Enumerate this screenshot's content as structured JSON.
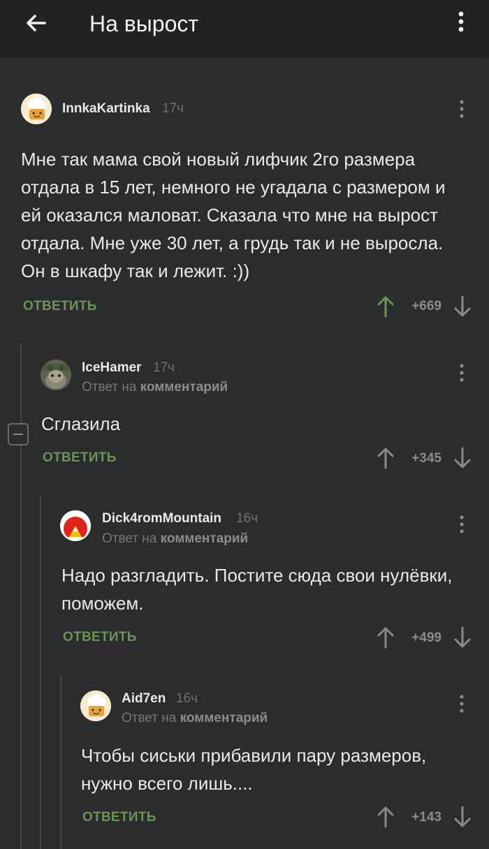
{
  "header": {
    "title": "На вырост",
    "back_icon": "arrow-left-icon",
    "menu_icon": "more-vertical-icon"
  },
  "comments": [
    {
      "username": "InnkaKartinka",
      "time": "17ч",
      "text": "Мне так мама свой новый лифчик 2го размера отдала в 15 лет, немного не угадала с размером и ей оказался маловат. Сказала что мне на вырост отдала. Мне уже 30 лет, а грудь так и не выросла. Он в шкафу так и лежит. :))",
      "reply_label": "ОТВЕТИТЬ",
      "score": "+669",
      "upvoted": true
    },
    {
      "username": "IceHamer",
      "time": "17ч",
      "reply_to_prefix": "Ответ на",
      "reply_to_target": "комментарий",
      "text": "Сглазила",
      "reply_label": "ОТВЕТИТЬ",
      "score": "+345",
      "upvoted": false
    },
    {
      "username": "Dick4romMountain",
      "time": "16ч",
      "reply_to_prefix": "Ответ на",
      "reply_to_target": "комментарий",
      "text": "Надо разгладить. Постите сюда свои нулёвки, поможем.",
      "reply_label": "ОТВЕТИТЬ",
      "score": "+499",
      "upvoted": false
    },
    {
      "username": "Aid7en",
      "time": "16ч",
      "reply_to_prefix": "Ответ на",
      "reply_to_target": "комментарий",
      "text": "Чтобы сиськи прибавили пару размеров, нужно всего лишь....",
      "reply_label": "ОТВЕТИТЬ",
      "score": "+143",
      "upvoted": false
    }
  ],
  "colors": {
    "background": "#2b2c2e",
    "header": "#212224",
    "reply": "#6b9456",
    "upvote_active": "#6b9456",
    "muted": "#8a8b8d"
  }
}
